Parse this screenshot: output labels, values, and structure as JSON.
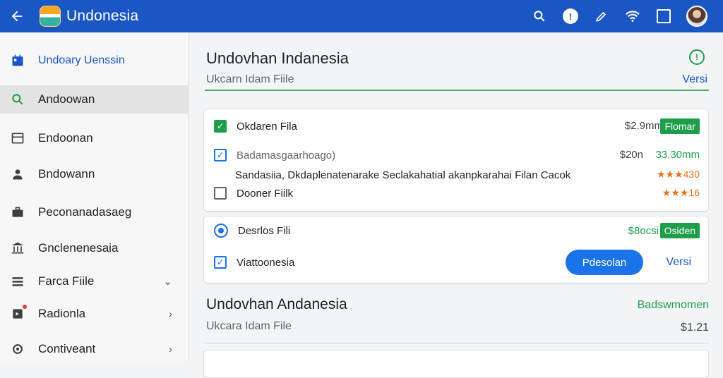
{
  "appbar": {
    "title": "Undonesia",
    "icons": [
      "back-arrow-icon",
      "app-logo-icon",
      "search-icon",
      "help-icon",
      "edit-icon",
      "wifi-icon",
      "window-icon",
      "avatar"
    ]
  },
  "sidebar": {
    "items": [
      {
        "label": "Undoary Uenssin",
        "icon": "calendar-icon"
      },
      {
        "label": "Andoowan",
        "icon": "search-icon"
      },
      {
        "label": "Endoonan",
        "icon": "list-icon"
      },
      {
        "label": "Bndowann",
        "icon": "person-icon"
      },
      {
        "label": "Peconanadasaeg",
        "icon": "briefcase-icon"
      },
      {
        "label": "Gnclenenesaia",
        "icon": "bank-icon"
      },
      {
        "label": "Farca Fiile",
        "icon": "menu-icon"
      },
      {
        "label": "Radionla",
        "icon": "notification-icon"
      },
      {
        "label": "Contiveant",
        "icon": "settings-icon"
      }
    ]
  },
  "header": {
    "title": "Undovhan Indanesia",
    "subtitle": "Ukcarn Idam Fiile",
    "link": "Versi"
  },
  "card1": {
    "row1": {
      "label": "Okdaren Fila",
      "price": "$2.9mm",
      "badge": "Flomar"
    },
    "row2": {
      "label": "Badamasgaarhoago)",
      "price": "$20n",
      "green": "33.30mm"
    },
    "row3": {
      "label": "Sandasiia, Dkdaplenatenarake Seclakahatial akanpkarahai Filan Cacok",
      "orange": "★★★430"
    },
    "row4": {
      "label": "Dooner Fiilk",
      "orange": "★★★16"
    }
  },
  "card2": {
    "row1": {
      "label": "Desrlos Fili",
      "green": "$8ocsi",
      "badge": "Osiden"
    },
    "row2": {
      "label": "Viattoonesia",
      "button": "Pdesolan",
      "link": "Versi"
    }
  },
  "section": {
    "title": "Undovhan Andanesia",
    "subtitle": "Ukcara Idam File",
    "green": "Badswmomen",
    "price": "$1.21"
  },
  "colors": {
    "primary": "#1a56c4",
    "accent_green": "#1e9e4a",
    "accent_orange": "#e8711c",
    "button_blue": "#1a73e8"
  }
}
